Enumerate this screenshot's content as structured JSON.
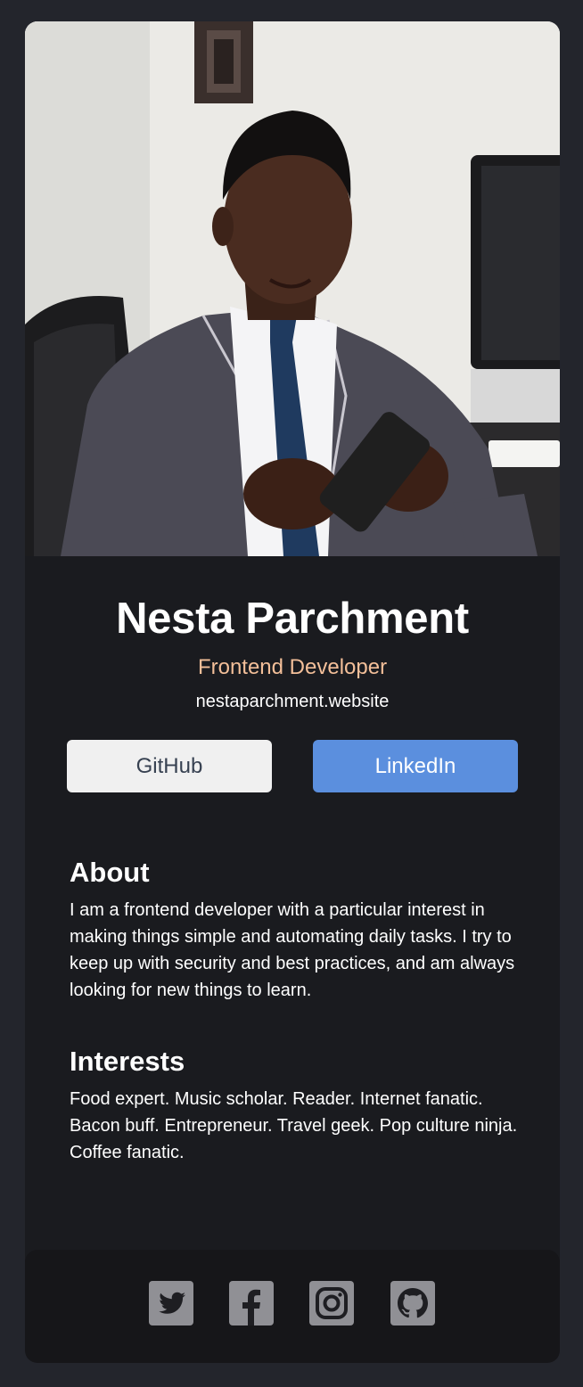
{
  "profile": {
    "name": "Nesta Parchment",
    "role": "Frontend Developer",
    "website": "nestaparchment.website"
  },
  "buttons": {
    "github_label": "GitHub",
    "linkedin_label": "LinkedIn"
  },
  "about": {
    "heading": "About",
    "text": "I am a frontend developer with a particular interest in making things simple and automating daily tasks. I try to keep up with security and best practices, and am always looking for new things to learn."
  },
  "interests": {
    "heading": "Interests",
    "text": "Food expert. Music scholar. Reader. Internet fanatic. Bacon buff. Entrepreneur. Travel geek. Pop culture ninja. Coffee fanatic."
  },
  "footer": {
    "icons": [
      "twitter-icon",
      "facebook-icon",
      "instagram-icon",
      "github-icon"
    ]
  },
  "colors": {
    "page_bg": "#23252c",
    "card_bg": "#1a1b1f",
    "footer_bg": "#161619",
    "role_accent": "#f3bf99",
    "linkedin_button": "#5b8fde",
    "github_button": "#f0f0f0",
    "social_icon": "#909095"
  }
}
